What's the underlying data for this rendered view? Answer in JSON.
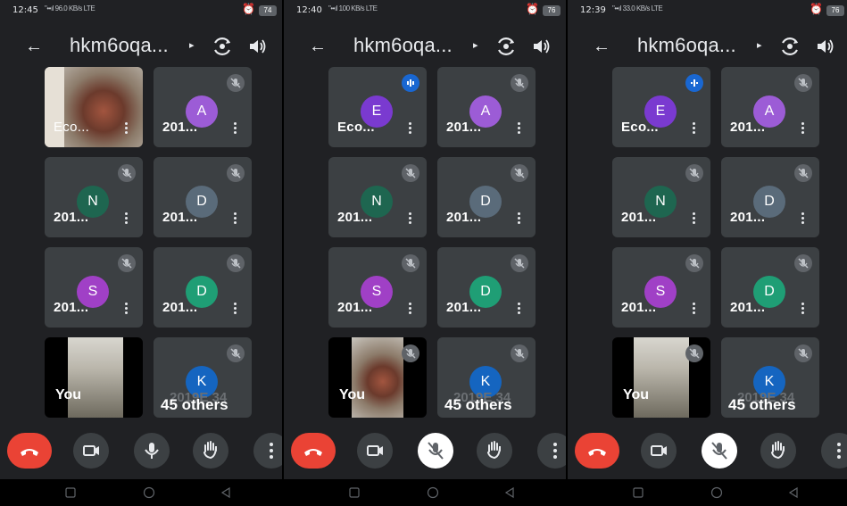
{
  "meeting": {
    "title": "hkm6oqa...",
    "others_label": "45 others",
    "others_hidden_label": "2019E 34",
    "you_label": "You"
  },
  "colors": {
    "background": "#202124",
    "tile": "#3c4043",
    "end_call": "#ea4335",
    "speaking": "#1967d2",
    "avatar_purple_a": "#9c5cd6",
    "avatar_green": "#1e6650",
    "avatar_slate": "#5a6b7a",
    "avatar_violet": "#a040c6",
    "avatar_teal": "#1f9e75",
    "avatar_blue": "#1565c0"
  },
  "panels": [
    {
      "status": {
        "time": "12:45",
        "signal": "\"••ıl 96.0 KB/s LTE",
        "alarm": "⏰",
        "battery": "74"
      },
      "first_tile": {
        "type": "video",
        "name": "Eco..."
      },
      "mic_state": "on",
      "mic_icon": "mic-icon"
    },
    {
      "status": {
        "time": "12:40",
        "signal": "\"••ıl 100 KB/s LTE",
        "alarm": "⏰",
        "battery": "76"
      },
      "first_tile": {
        "type": "avatar",
        "initial": "E",
        "name": "Eco..."
      },
      "mic_state": "muted",
      "mic_icon": "mic-off-icon"
    },
    {
      "status": {
        "time": "12:39",
        "signal": "\"••ıl 33.0 KB/s LTE",
        "alarm": "⏰",
        "battery": "76"
      },
      "first_tile": {
        "type": "avatar",
        "initial": "E",
        "name": "Eco..."
      },
      "mic_state": "muted",
      "mic_icon": "mic-off-icon"
    }
  ],
  "participants": [
    {
      "initial": "A",
      "name": "201...",
      "color": "#9c5cd6"
    },
    {
      "initial": "N",
      "name": "201...",
      "color": "#1e6650"
    },
    {
      "initial": "D",
      "name": "201...",
      "color": "#5a6b7a"
    },
    {
      "initial": "S",
      "name": "201...",
      "color": "#a040c6"
    },
    {
      "initial": "D",
      "name": "201...",
      "color": "#1f9e75"
    },
    {
      "initial": "K",
      "name": "",
      "color": "#1565c0"
    }
  ],
  "first_avatar_color": "#7a3ad0"
}
